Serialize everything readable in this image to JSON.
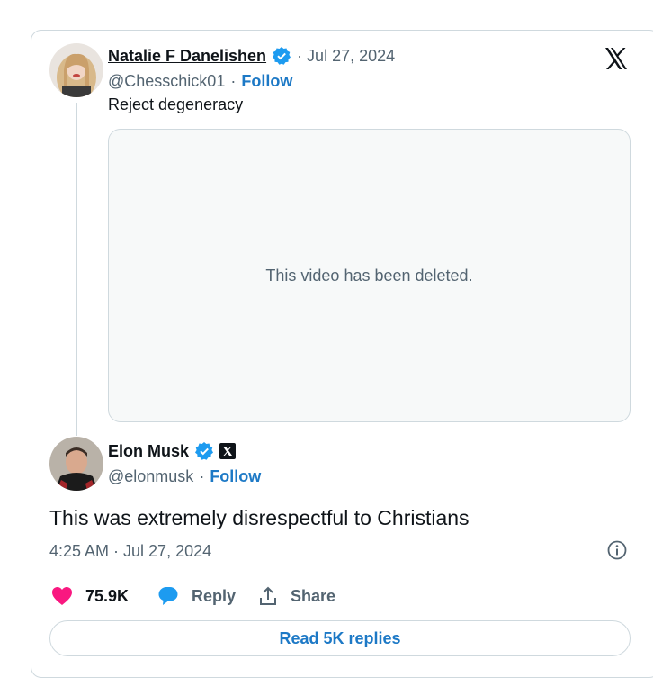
{
  "original_tweet": {
    "author_name": "Natalie F Danelishen",
    "date": "· Jul 27, 2024",
    "handle": "@Chesschick01",
    "separator": "·",
    "follow_label": "Follow",
    "text": "Reject degeneracy",
    "media_placeholder": "This video has been deleted."
  },
  "reply_tweet": {
    "author_name": "Elon Musk",
    "handle": "@elonmusk",
    "separator": "·",
    "follow_label": "Follow",
    "text": "This was extremely disrespectful to Christians",
    "timestamp": "4:25 AM · Jul 27, 2024"
  },
  "actions": {
    "like_count": "75.9K",
    "reply_label": "Reply",
    "share_label": "Share"
  },
  "read_replies_label": "Read 5K replies",
  "colors": {
    "accent": "#1d79c6",
    "verified": "#1d9bf0",
    "like": "#f91880",
    "border": "#cfd9de",
    "muted": "#536471"
  },
  "icons": [
    "x-logo-icon",
    "verified-badge-icon",
    "x-affiliate-badge-icon",
    "heart-icon",
    "reply-bubble-icon",
    "share-icon",
    "info-icon"
  ]
}
